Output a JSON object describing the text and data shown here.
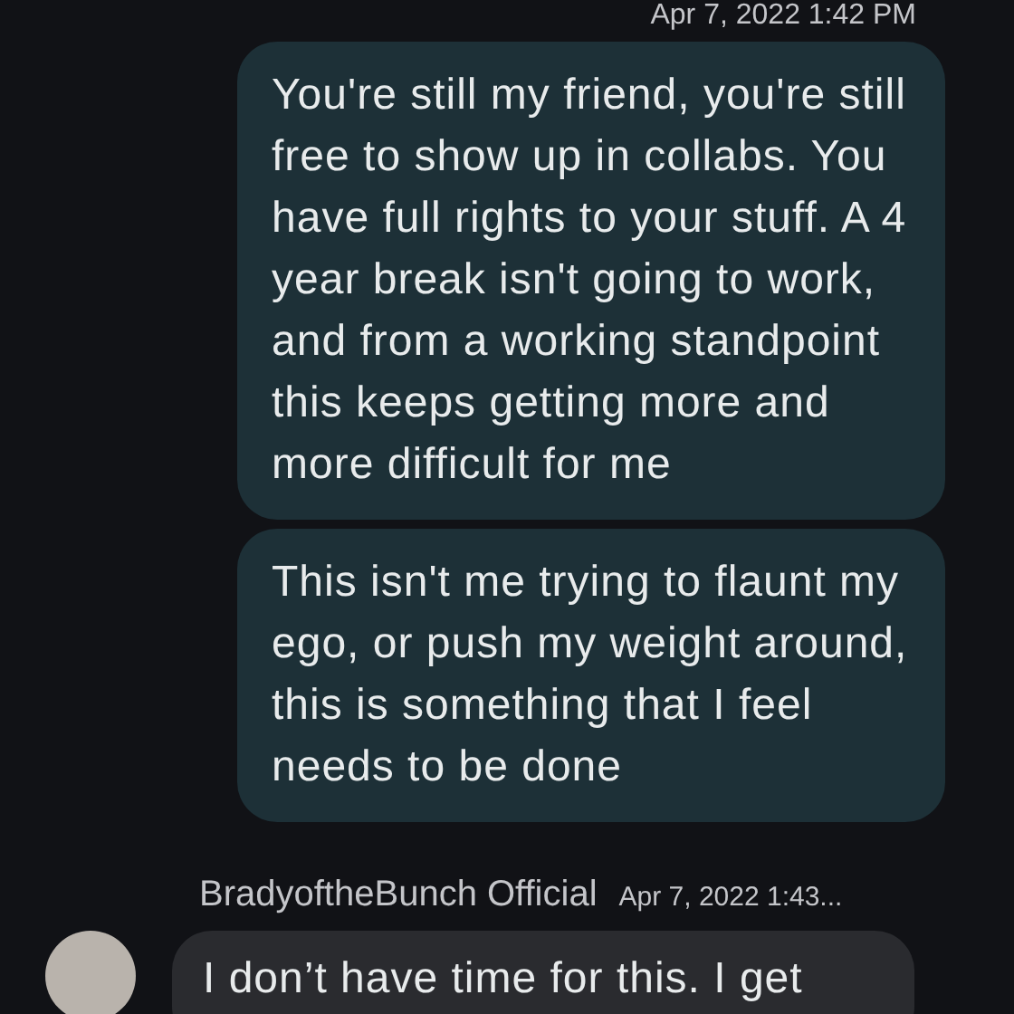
{
  "top_timestamp": "Apr 7, 2022 1:42 PM",
  "messages": [
    {
      "kind": "outgoing",
      "text": "You're still my friend, you're still free to show up in collabs. You have full rights to your stuff. A 4 year break isn't going to work, and from a working standpoint this keeps getting more and more difficult for me"
    },
    {
      "kind": "outgoing",
      "text": "This isn't me trying to flaunt my ego, or push my weight around, this is something that I feel needs to be done"
    },
    {
      "kind": "incoming",
      "sender": "BradyoftheBunch Official",
      "time": "Apr 7, 2022 1:43...",
      "text": "I don’t have time for this. I get"
    }
  ]
}
